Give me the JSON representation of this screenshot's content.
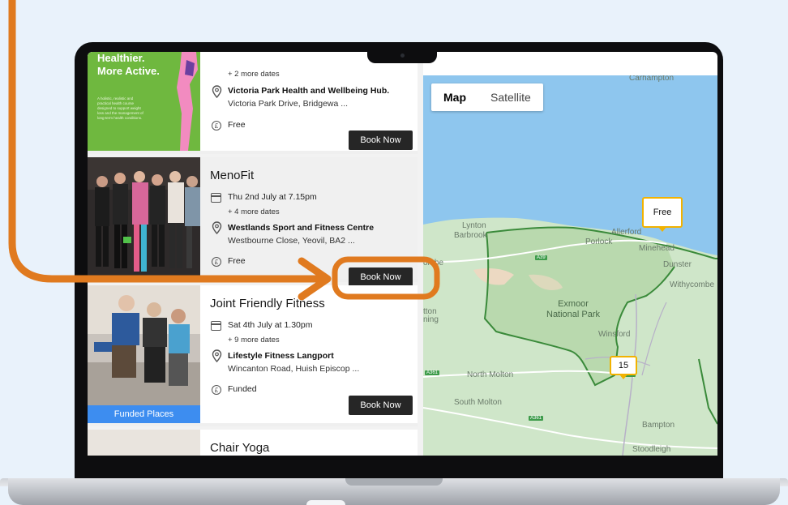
{
  "colors": {
    "accent": "#e07a1f",
    "button": "#262626",
    "funded": "#3d8df0",
    "marker": "#f2b200",
    "park_border": "#3a8a3a"
  },
  "listing": {
    "card1": {
      "promo_line1": "Healthier.",
      "promo_line2": "More Active.",
      "promo_text": "A holistic, realistic and practical health course designed to support weight loss and the management of long-term health conditions.",
      "more_dates": "+ 2 more dates",
      "venue": "Victoria Park Health and Wellbeing Hub.",
      "address": "Victoria Park Drive, Bridgewa ...",
      "price": "Free",
      "book_label": "Book Now"
    },
    "card2": {
      "title": "MenoFit",
      "date": "Thu 2nd July at 7.15pm",
      "more_dates": "+ 4 more dates",
      "venue": "Westlands Sport and Fitness Centre",
      "address": "Westbourne Close, Yeovil, BA2 ...",
      "price": "Free",
      "book_label": "Book Now"
    },
    "card3": {
      "title": "Joint Friendly Fitness",
      "date": "Sat 4th July at 1.30pm",
      "more_dates": "+ 9 more dates",
      "venue": "Lifestyle Fitness Langport",
      "address": "Wincanton Road, Huish Episcop ...",
      "price": "Funded",
      "badge": "Funded Places",
      "book_label": "Book Now"
    },
    "card4": {
      "title": "Chair Yoga"
    }
  },
  "map": {
    "toggle": {
      "map": "Map",
      "satellite": "Satellite"
    },
    "markers": {
      "free": "Free",
      "count": "15"
    },
    "labels": {
      "exmoor": "Exmoor\nNational Park",
      "lynton": "Lynton",
      "barbrook": "Barbrook",
      "porlock": "Porlock",
      "allerford": "Allerford",
      "minehead": "Minehead",
      "dunster": "Dunster",
      "withycombe": "Withycombe",
      "winsford": "Winsford",
      "north_molton": "North Molton",
      "south_molton": "South Molton",
      "bampton": "Bampton",
      "stoodleigh": "Stoodleigh",
      "combe": "ombe",
      "ton": "tton",
      "ning": "ning",
      "top_label": "Carhampton"
    },
    "roads": {
      "a39": "A39",
      "a361": "A361",
      "a361b": "A361",
      "a396": "A396"
    }
  }
}
